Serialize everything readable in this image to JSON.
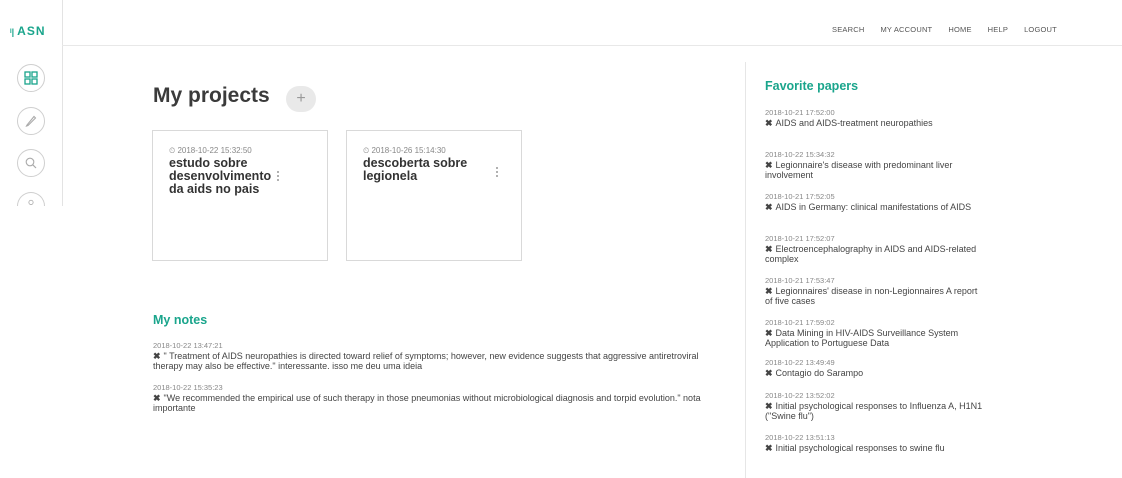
{
  "brand": {
    "mark": "ᴵ|",
    "name": "ASN",
    "accent": "#1aa58c"
  },
  "rail": {
    "icons": [
      "grid-icon",
      "pencil-icon",
      "search-icon",
      "gear-icon"
    ]
  },
  "nav": {
    "items": [
      "SEARCH",
      "MY ACCOUNT",
      "HOME",
      "HELP",
      "LOGOUT"
    ]
  },
  "projects": {
    "title": "My projects",
    "add_label": "+",
    "items": [
      {
        "date": "⏲ 2018-10-22 15:32:50",
        "title": "estudo sobre desenvolvimento da aids no pais"
      },
      {
        "date": "⏲ 2018-10-26 15:14:30",
        "title": "descoberta sobre legionela"
      }
    ]
  },
  "notes": {
    "title": "My notes",
    "items": [
      {
        "date": "2018-10-22 13:47:21",
        "text": "\" Treatment of AIDS neuropathies is directed toward relief of symptoms; however, new evidence suggests that aggressive antiretroviral therapy may also be effective.\" interessante. isso me deu uma ideia"
      },
      {
        "date": "2018-10-22 15:35:23",
        "text": "\"We recommended the empirical use of such therapy in those pneumonias without microbiological diagnosis and torpid evolution.\" nota importante"
      }
    ]
  },
  "favorites": {
    "title": "Favorite papers",
    "items": [
      {
        "date": "2018-10-21 17:52:00",
        "text": "AIDS and AIDS-treatment neuropathies"
      },
      {
        "date": "2018-10-22 15:34:32",
        "text": "Legionnaire's disease with predominant liver involvement"
      },
      {
        "date": "2018-10-21 17:52:05",
        "text": "AIDS in Germany: clinical manifestations of AIDS"
      },
      {
        "date": "2018-10-21 17:52:07",
        "text": "Electroencephalography in AIDS and AIDS-related complex"
      },
      {
        "date": "2018-10-21 17:53:47",
        "text": "Legionnaires' disease in non-Legionnaires A report of five cases"
      },
      {
        "date": "2018-10-21 17:59:02",
        "text": "Data Mining in HIV-AIDS Surveillance System Application to Portuguese Data"
      },
      {
        "date": "2018-10-22 13:49:49",
        "text": "Contagio do Sarampo"
      },
      {
        "date": "2018-10-22 13:52:02",
        "text": "Initial psychological responses to Influenza A, H1N1 (\"Swine flu\")"
      },
      {
        "date": "2018-10-22 13:51:13",
        "text": "Initial psychological responses to swine flu"
      }
    ]
  },
  "remove_glyph": "✖"
}
